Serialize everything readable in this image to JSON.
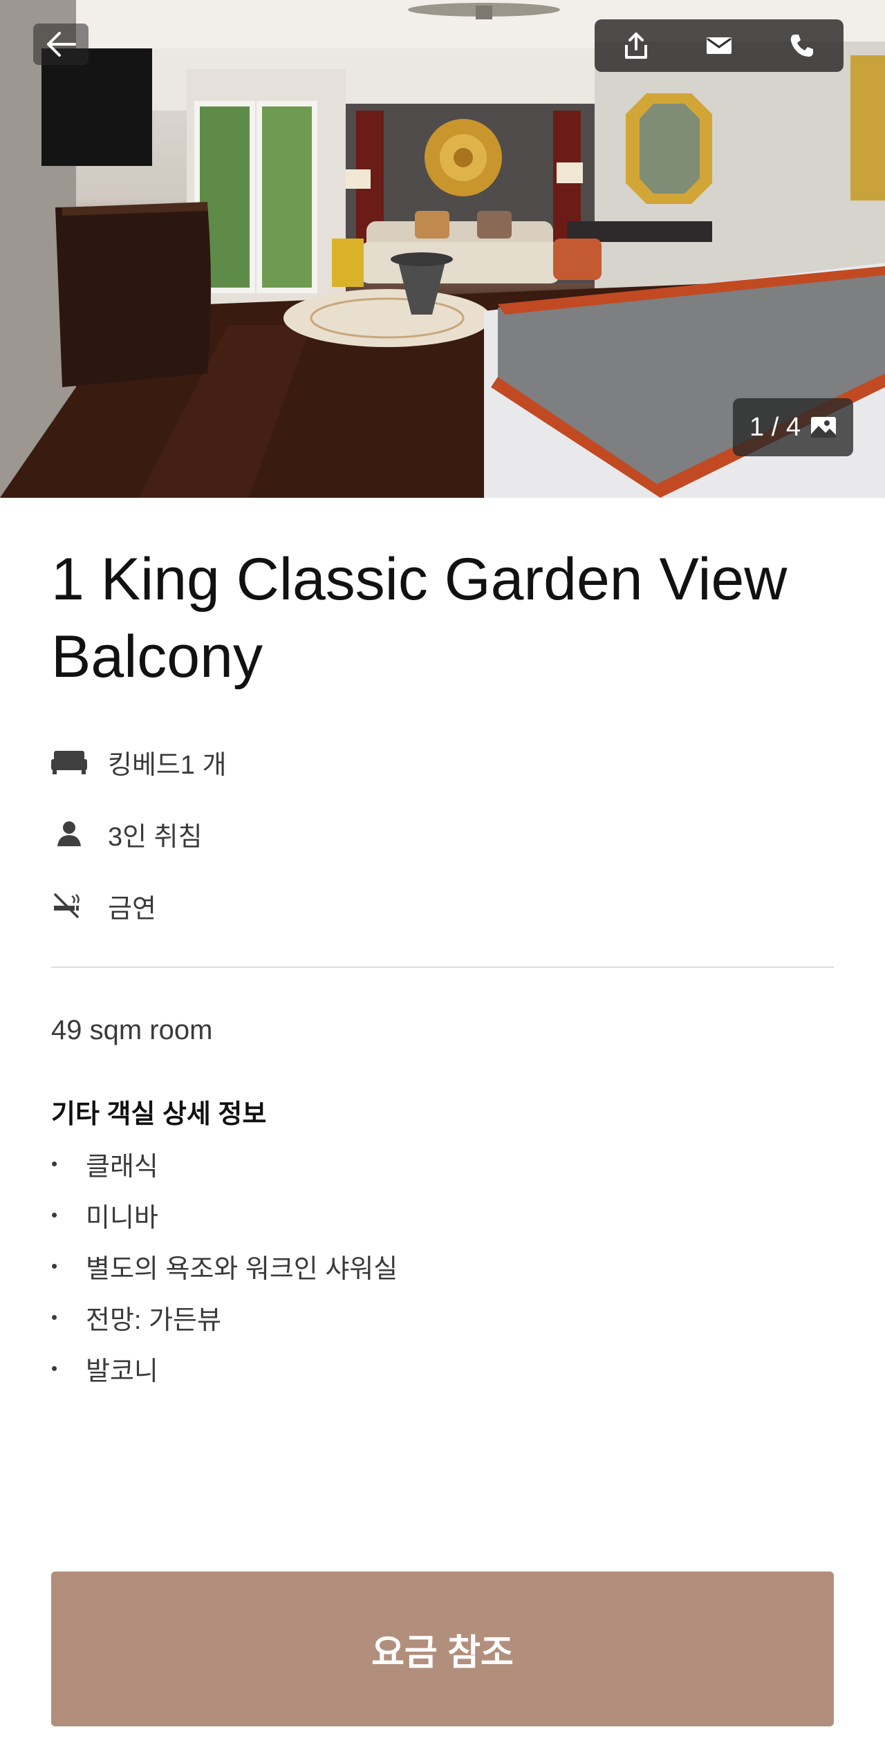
{
  "photo": {
    "description_icon": "hotel-room-photo",
    "counter": {
      "current": 1,
      "total": 4,
      "label": "1 / 4"
    }
  },
  "header": {
    "back_icon": "arrow-left-icon",
    "actions": [
      {
        "name": "share",
        "icon": "share-icon"
      },
      {
        "name": "email",
        "icon": "mail-icon"
      },
      {
        "name": "call",
        "icon": "phone-icon"
      }
    ]
  },
  "room": {
    "title": "1 King Classic Garden View Balcony",
    "features": [
      {
        "icon": "bed-icon",
        "label": "킹베드1 개"
      },
      {
        "icon": "person-icon",
        "label": "3인 취침"
      },
      {
        "icon": "no-smoking-icon",
        "label": "금연"
      }
    ],
    "size": "49 sqm room",
    "details_title": "기타 객실 상세 정보",
    "details": [
      "클래식",
      "미니바",
      "별도의 욕조와 워크인 샤워실",
      "전망: 가든뷰",
      "발코니"
    ]
  },
  "cta": {
    "label": "요금 참조",
    "color": "#b28f7c"
  }
}
